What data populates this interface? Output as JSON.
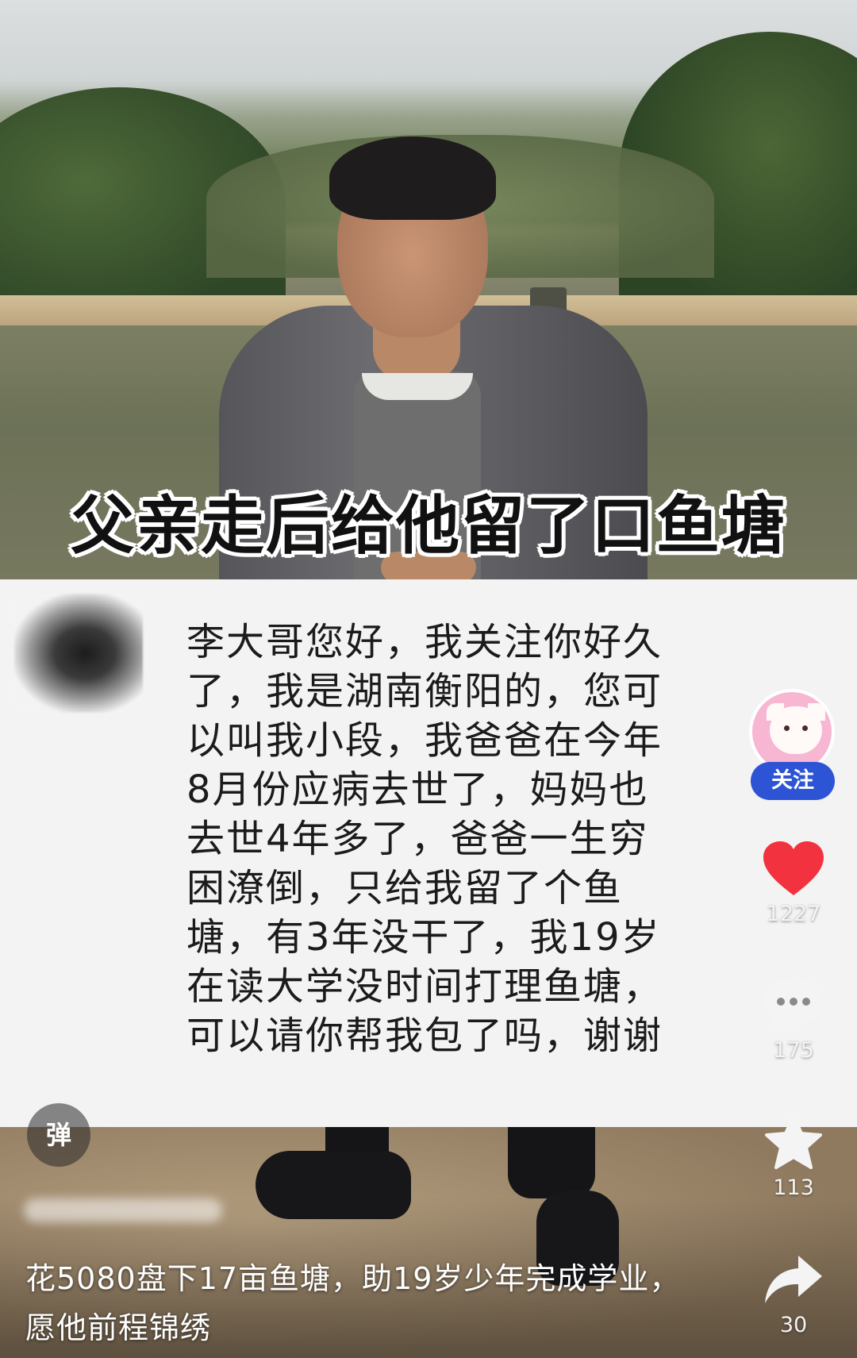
{
  "video": {
    "caption": "父亲走后给他留了口鱼塘"
  },
  "message": {
    "lines": [
      "李大哥您好，我关注你好久",
      "了，我是湖南衡阳的，您可",
      "以叫我小段，我爸爸在今年",
      "8月份应病去世了，妈妈也",
      "去世4年多了，爸爸一生穷",
      "困潦倒，只给我留了个鱼",
      "塘，有3年没干了，我19岁",
      "在读大学没时间打理鱼塘，",
      "可以请你帮我包了吗，谢谢"
    ]
  },
  "rail": {
    "follow_label": "关注",
    "like_count": "1227",
    "comment_count": "175",
    "favorite_count": "113",
    "share_count": "30"
  },
  "danmaku": {
    "label": "弹"
  },
  "description": {
    "line1": "花5080盘下17亩鱼塘，助19岁少年完成学业，",
    "line2": "愿他前程锦绣"
  },
  "colors": {
    "like_red": "#f2333f",
    "follow_blue": "#2e54d6",
    "message_bg": "#f3f3f3"
  },
  "icons": [
    "heart-icon",
    "comment-icon",
    "star-icon",
    "share-icon",
    "creator-avatar"
  ]
}
